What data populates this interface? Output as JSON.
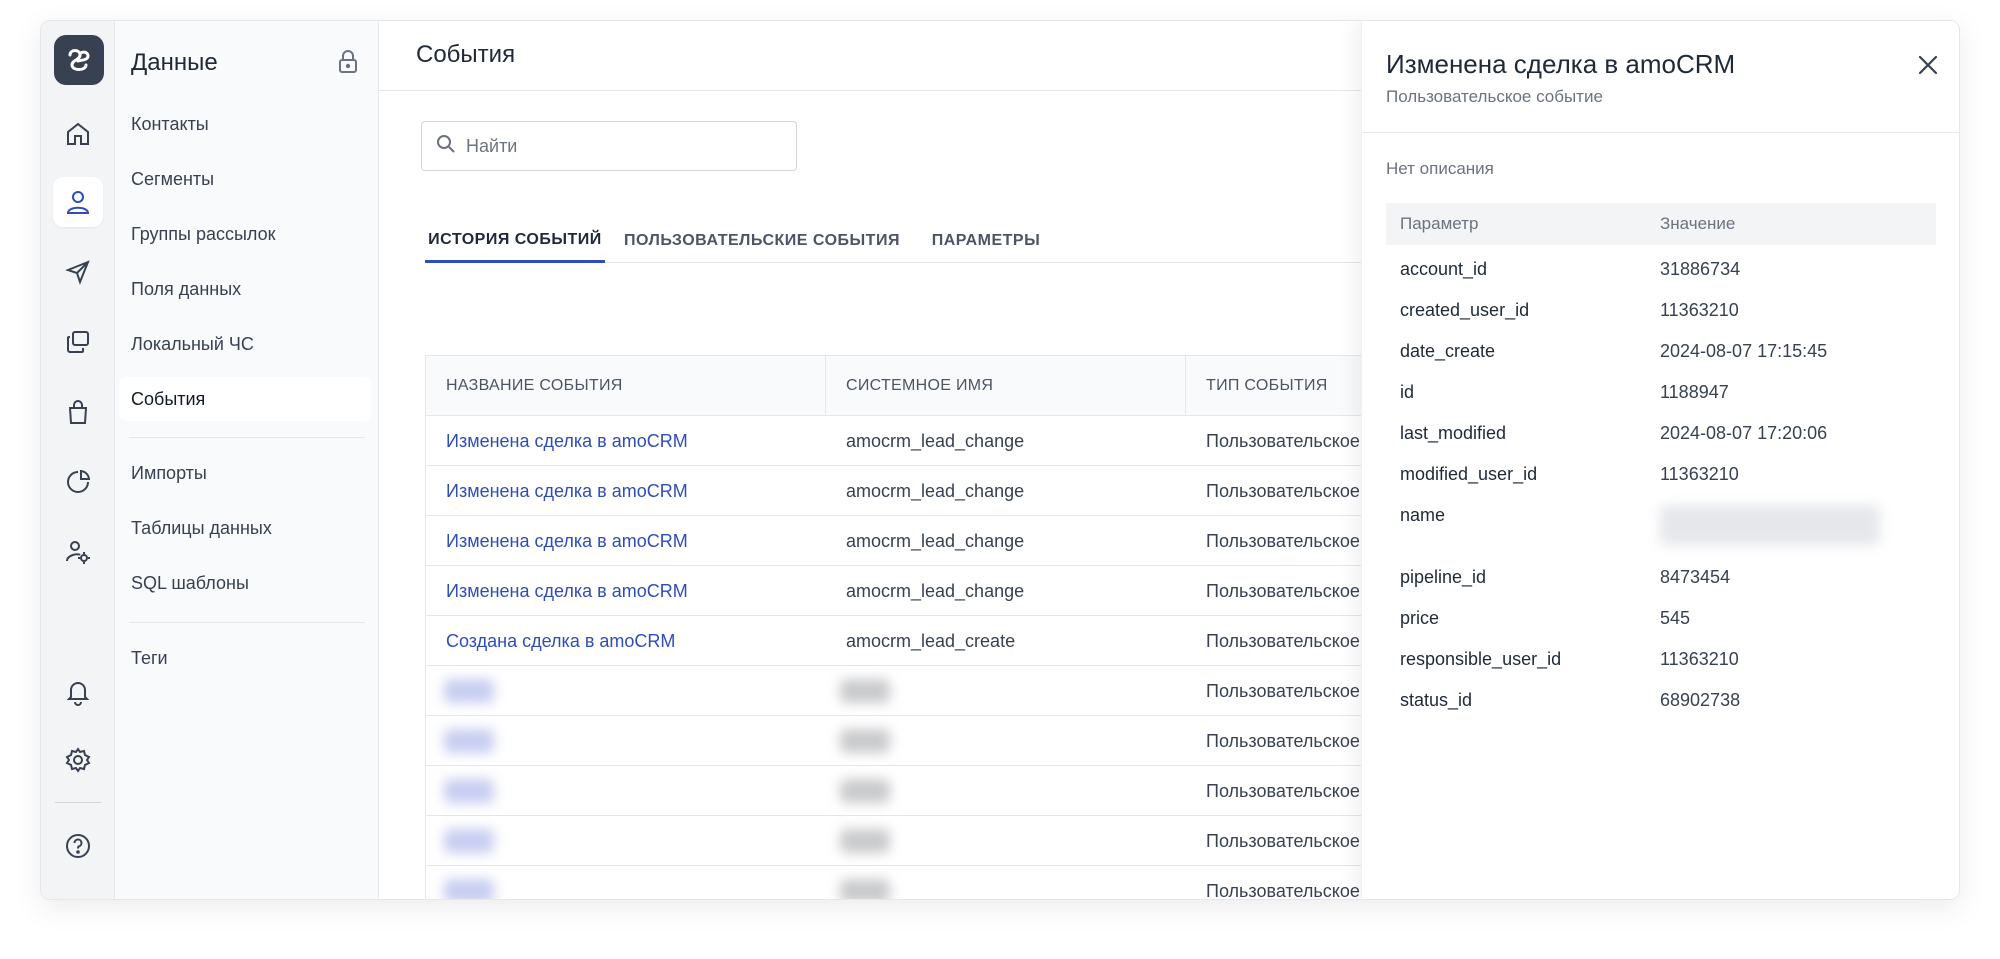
{
  "nav": {
    "title": "Данные",
    "items": [
      "Контакты",
      "Сегменты",
      "Группы рассылок",
      "Поля данных",
      "Локальный ЧС",
      "События"
    ],
    "items2": [
      "Импорты",
      "Таблицы данных",
      "SQL шаблоны"
    ],
    "items3": [
      "Теги"
    ]
  },
  "page": {
    "title": "События",
    "search_placeholder": "Найти"
  },
  "tabs": [
    "ИСТОРИЯ СОБЫТИЙ",
    "ПОЛЬЗОВАТЕЛЬСКИЕ СОБЫТИЯ",
    "ПАРАМЕТРЫ"
  ],
  "table": {
    "headers": [
      "НАЗВАНИЕ СОБЫТИЯ",
      "СИСТЕМНОЕ ИМЯ",
      "ТИП СОБЫТИЯ"
    ],
    "rows": [
      [
        "Изменена сделка в amoCRM",
        "amocrm_lead_change",
        "Пользовательское"
      ],
      [
        "Изменена сделка в amoCRM",
        "amocrm_lead_change",
        "Пользовательское"
      ],
      [
        "Изменена сделка в amoCRM",
        "amocrm_lead_change",
        "Пользовательское"
      ],
      [
        "Изменена сделка в amoCRM",
        "amocrm_lead_change",
        "Пользовательское"
      ],
      [
        "Создана сделка в amoCRM",
        "amocrm_lead_create",
        "Пользовательское"
      ],
      [
        "",
        "",
        "Пользовательское"
      ],
      [
        "",
        "",
        "Пользовательское"
      ],
      [
        "",
        "",
        "Пользовательское"
      ],
      [
        "",
        "",
        "Пользовательское"
      ],
      [
        "",
        "",
        "Пользовательское"
      ]
    ]
  },
  "panel": {
    "title": "Изменена сделка в amoCRM",
    "subtitle": "Пользовательское событие",
    "description": "Нет описания",
    "col_param": "Параметр",
    "col_value": "Значение",
    "params": [
      [
        "account_id",
        "31886734"
      ],
      [
        "created_user_id",
        "11363210"
      ],
      [
        "date_create",
        "2024-08-07 17:15:45"
      ],
      [
        "id",
        "1188947"
      ],
      [
        "last_modified",
        "2024-08-07 17:20:06"
      ],
      [
        "modified_user_id",
        "11363210"
      ],
      [
        "name",
        ""
      ],
      [
        "pipeline_id",
        "8473454"
      ],
      [
        "price",
        "545"
      ],
      [
        "responsible_user_id",
        "11363210"
      ],
      [
        "status_id",
        "68902738"
      ]
    ]
  },
  "colors": {
    "accent": "#2f4db8",
    "logo_bg": "#374151"
  }
}
